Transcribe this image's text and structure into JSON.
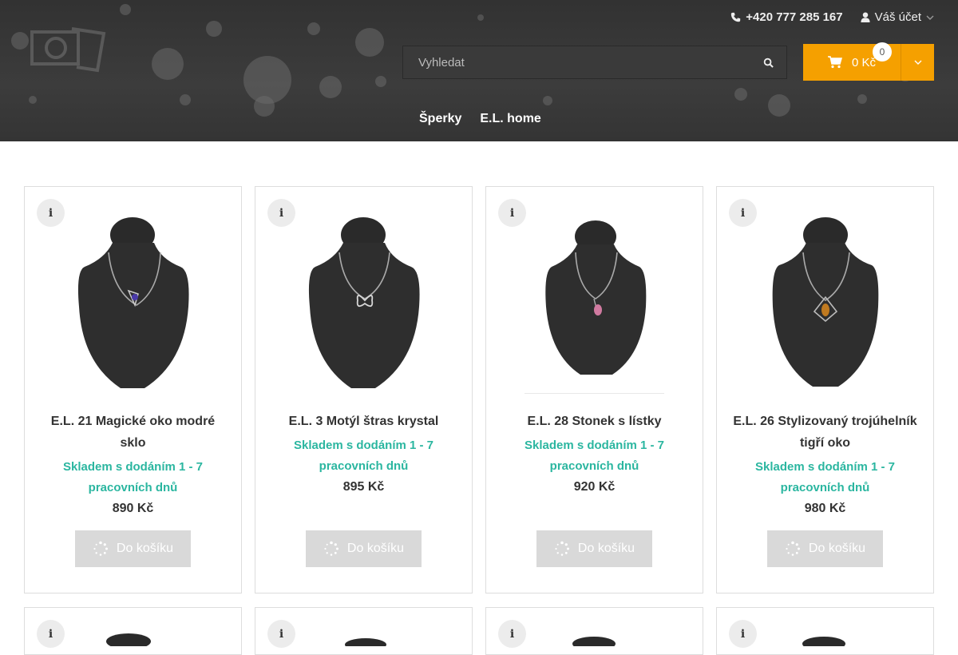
{
  "header": {
    "phone": "+420 777 285 167",
    "account": "Váš účet",
    "search_placeholder": "Vyhledat",
    "cart_total": "0 Kč",
    "cart_count": "0",
    "accent_color": "#f5a000"
  },
  "nav": [
    {
      "label": "Šperky"
    },
    {
      "label": "E.L. home"
    }
  ],
  "products": [
    {
      "title": "E.L. 21 Magické oko modré sklo",
      "availability": "Skladem s dodáním 1 - 7 pracovních dnů",
      "price": "890 Kč",
      "button": "Do košíku",
      "pendant_color": "#4a3aa8"
    },
    {
      "title": "E.L. 3 Motýl štras krystal",
      "availability": "Skladem s dodáním 1 - 7 pracovních dnů",
      "price": "895 Kč",
      "button": "Do košíku",
      "pendant_color": "#d8d8d8"
    },
    {
      "title": "E.L. 28 Stonek s lístky",
      "availability": "Skladem s dodáním 1 - 7 pracovních dnů",
      "price": "920 Kč",
      "button": "Do košíku",
      "pendant_color": "#d07aa0"
    },
    {
      "title": "E.L. 26 Stylizovaný trojúhelník tigří oko",
      "availability": "Skladem s dodáním 1 - 7 pracovních dnů",
      "price": "980 Kč",
      "button": "Do košíku",
      "pendant_color": "#c07a20"
    }
  ],
  "icons": {
    "phone": "phone-icon",
    "user": "user-icon",
    "search": "search-icon",
    "cart": "cart-icon",
    "info": "info-icon",
    "spinner": "spinner-icon"
  }
}
